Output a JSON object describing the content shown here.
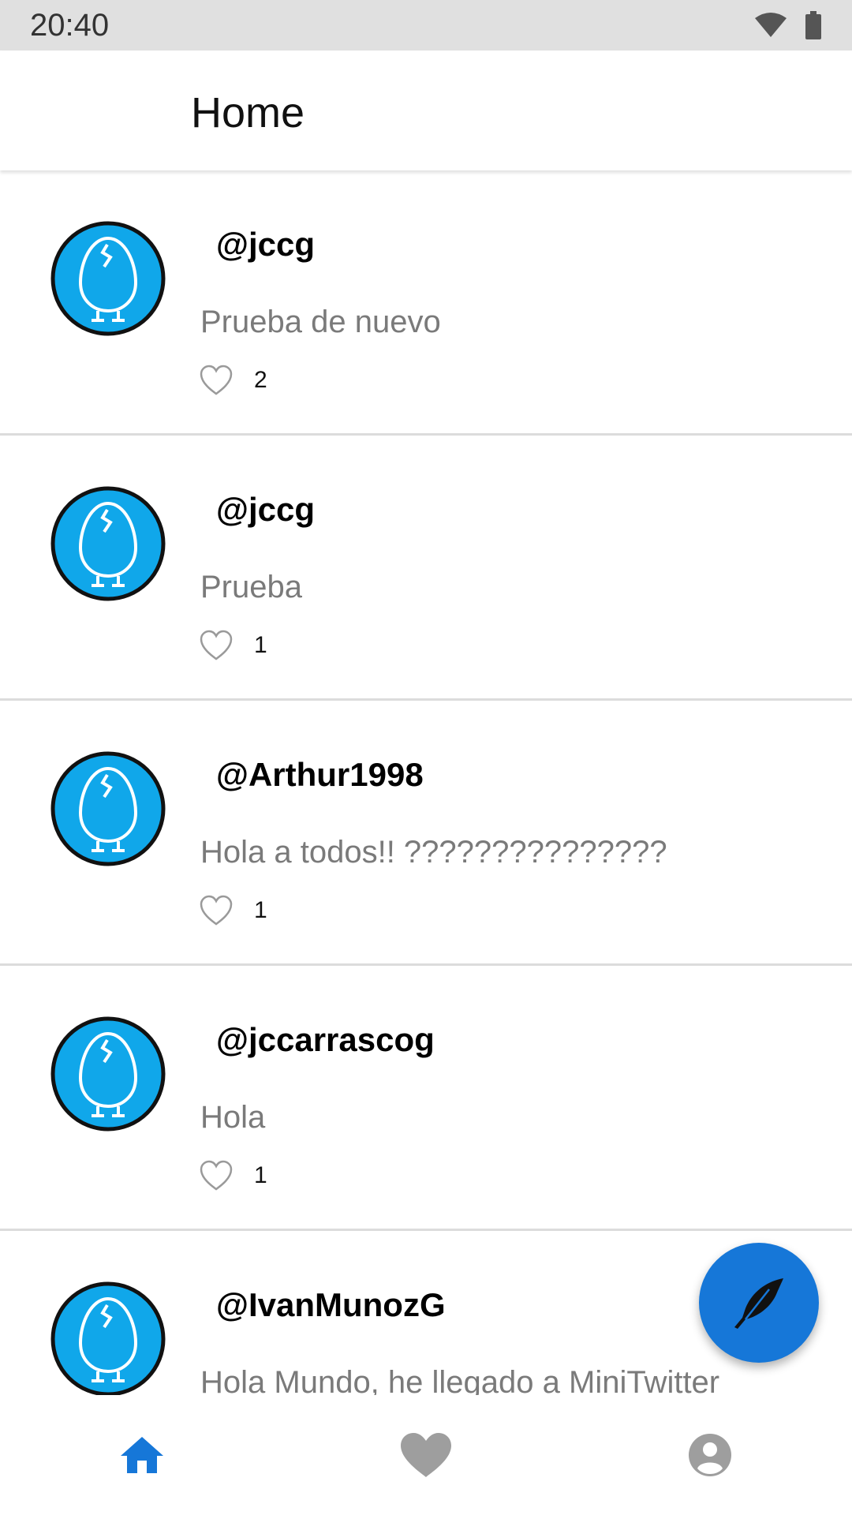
{
  "status_bar": {
    "time": "20:40",
    "icons": [
      "wifi-icon",
      "battery-icon"
    ]
  },
  "app_bar": {
    "title": "Home"
  },
  "colors": {
    "accent": "#1677d8",
    "avatar_fill": "#10a7ea",
    "text_secondary": "#7a7a7a",
    "nav_inactive": "#9e9e9e"
  },
  "tweets": [
    {
      "username": "@jccg",
      "text": "Prueba de nuevo",
      "likes": "2"
    },
    {
      "username": "@jccg",
      "text": "Prueba",
      "likes": "1"
    },
    {
      "username": "@Arthur1998",
      "text": "Hola a todos!! ???????????????",
      "likes": "1"
    },
    {
      "username": "@jccarrascog",
      "text": "Hola",
      "likes": "1"
    },
    {
      "username": "@IvanMunozG",
      "text": "Hola Mundo, he llegado a MiniTwitter",
      "likes": ""
    }
  ],
  "fab": {
    "icon": "feather-icon"
  },
  "bottom_nav": {
    "items": [
      {
        "name": "home",
        "icon": "home-icon",
        "active": true
      },
      {
        "name": "favorites",
        "icon": "heart-icon",
        "active": false
      },
      {
        "name": "profile",
        "icon": "account-icon",
        "active": false
      }
    ]
  }
}
